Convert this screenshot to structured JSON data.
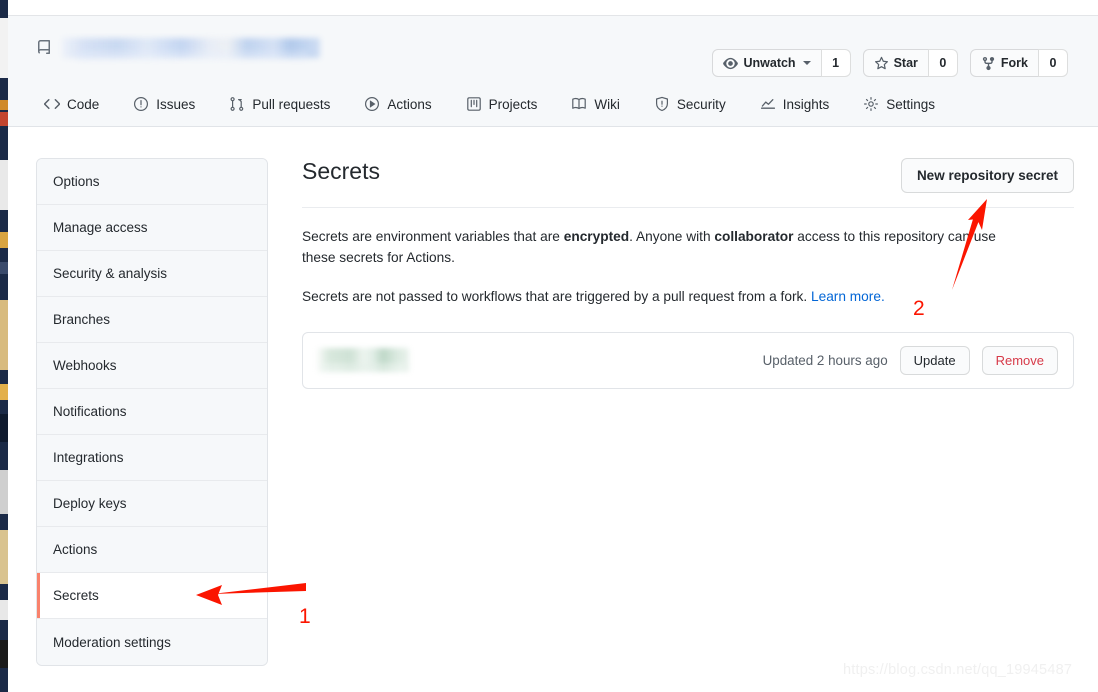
{
  "browser": {
    "background_window_present": true
  },
  "repo_header": {
    "repo_icon": "repo-icon",
    "repo_name_redacted": true,
    "actions": [
      {
        "id": "watch",
        "icon": "eye-icon",
        "label": "Unwatch",
        "has_caret": true,
        "count": "1"
      },
      {
        "id": "star",
        "icon": "star-icon",
        "label": "Star",
        "has_caret": false,
        "count": "0"
      },
      {
        "id": "fork",
        "icon": "fork-icon",
        "label": "Fork",
        "has_caret": false,
        "count": "0"
      }
    ],
    "tabs": [
      {
        "id": "code",
        "label": "Code",
        "icon": "code-icon"
      },
      {
        "id": "issues",
        "label": "Issues",
        "icon": "issue-opened-icon"
      },
      {
        "id": "pull-requests",
        "label": "Pull requests",
        "icon": "git-pull-request-icon"
      },
      {
        "id": "actions",
        "label": "Actions",
        "icon": "play-icon"
      },
      {
        "id": "projects",
        "label": "Projects",
        "icon": "project-icon"
      },
      {
        "id": "wiki",
        "label": "Wiki",
        "icon": "book-icon"
      },
      {
        "id": "security",
        "label": "Security",
        "icon": "shield-icon"
      },
      {
        "id": "insights",
        "label": "Insights",
        "icon": "graph-icon"
      },
      {
        "id": "settings",
        "label": "Settings",
        "icon": "gear-icon"
      }
    ]
  },
  "sidebar": {
    "items": [
      {
        "id": "options",
        "label": "Options",
        "selected": false
      },
      {
        "id": "manage-access",
        "label": "Manage access",
        "selected": false
      },
      {
        "id": "security-analysis",
        "label": "Security & analysis",
        "selected": false
      },
      {
        "id": "branches",
        "label": "Branches",
        "selected": false
      },
      {
        "id": "webhooks",
        "label": "Webhooks",
        "selected": false
      },
      {
        "id": "notifications",
        "label": "Notifications",
        "selected": false
      },
      {
        "id": "integrations",
        "label": "Integrations",
        "selected": false
      },
      {
        "id": "deploy-keys",
        "label": "Deploy keys",
        "selected": false
      },
      {
        "id": "actions",
        "label": "Actions",
        "selected": false
      },
      {
        "id": "secrets",
        "label": "Secrets",
        "selected": true
      },
      {
        "id": "moderation-settings",
        "label": "Moderation settings",
        "selected": false
      }
    ],
    "selected_accent": "#f9826c"
  },
  "main": {
    "title": "Secrets",
    "new_secret_button": "New repository secret",
    "paragraph1": {
      "part1": "Secrets are environment variables that are ",
      "bold1": "encrypted",
      "part2": ". Anyone with ",
      "bold2": "collaborator",
      "part3": " access to this repository can use these secrets for Actions."
    },
    "paragraph2": {
      "text": "Secrets are not passed to workflows that are triggered by a pull request from a fork. ",
      "link_text": "Learn more.",
      "link_color": "#0366d6"
    },
    "secrets": [
      {
        "name_redacted": true,
        "updated": "Updated 2 hours ago",
        "update_label": "Update",
        "remove_label": "Remove"
      }
    ]
  },
  "annotations": {
    "color": "#fb1500",
    "markers": [
      {
        "id": "1",
        "label": "1",
        "target": "sidebar-item-secrets",
        "direction": "left"
      },
      {
        "id": "2",
        "label": "2",
        "target": "new-repository-secret-button",
        "direction": "up-right"
      }
    ]
  },
  "watermark": {
    "text": "https://blog.csdn.net/qq_19945487"
  }
}
